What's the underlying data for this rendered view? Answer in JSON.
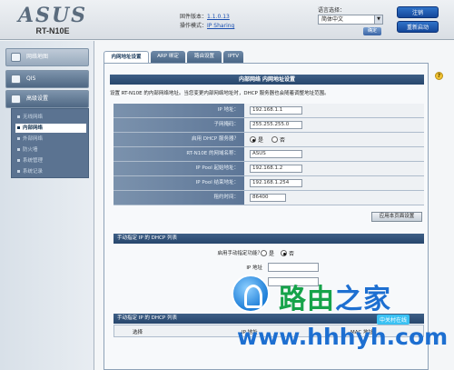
{
  "brand": {
    "logo": "ASUS",
    "model": "RT-N10E"
  },
  "firmware": {
    "label": "固件版本：",
    "value": "1.1.0.13"
  },
  "mode": {
    "label": "操作模式：",
    "value": "IP Sharing"
  },
  "language": {
    "label": "语言选择：",
    "selected": "简体中文",
    "ok_label": "确定"
  },
  "header_buttons": {
    "logout": "注销",
    "reboot": "重新启动"
  },
  "sidebar": {
    "network_map": "网络地图",
    "qis": "QIS",
    "advanced": "高级设置",
    "sub_items": [
      "无线网络",
      "内部网络",
      "外部网络",
      "防火墙",
      "系统管理",
      "系统记录"
    ]
  },
  "tabs": [
    "内网地址设置",
    "ARP 绑定",
    "路由设置",
    "IPTV"
  ],
  "panel": {
    "title": "内部网络 内网地址设置",
    "description": "设置 RT-N10E 的内部网络地址。当您变更内部网络地址时，DHCP 服务器也会随着调整地址范围。"
  },
  "fields": [
    {
      "label": "IP 地址：",
      "value": "192.168.1.1"
    },
    {
      "label": "子网掩码：",
      "value": "255.255.255.0"
    },
    {
      "label": "启用 DHCP 服务器？",
      "value": ""
    },
    {
      "label": "RT-N10E 的网域名称：",
      "value": "ASUS"
    },
    {
      "label": "IP Pool 起始地址：",
      "value": "192.168.1.2"
    },
    {
      "label": "IP Pool 结束地址：",
      "value": "192.168.1.254"
    },
    {
      "label": "租约时间：",
      "value": "86400"
    }
  ],
  "radio": {
    "yes": "是",
    "no": "否"
  },
  "apply_label": "应用本页面设置",
  "manual_section": {
    "head": "手动指定 IP 的 DHCP 列表",
    "enable_label": "启用手动指定功能？",
    "ip_label": "IP 地址",
    "mac_label": "MAC 地址"
  },
  "list_section": {
    "head": "手动指定 IP 的 DHCP 列表",
    "col_select": "选择",
    "col_ip": "IP 地址",
    "col_mac": "MAC 地址"
  },
  "watermark": {
    "title_a": "路由",
    "title_b": "之家",
    "url": "www.hhhyh.com",
    "tag": "中关村在线"
  }
}
